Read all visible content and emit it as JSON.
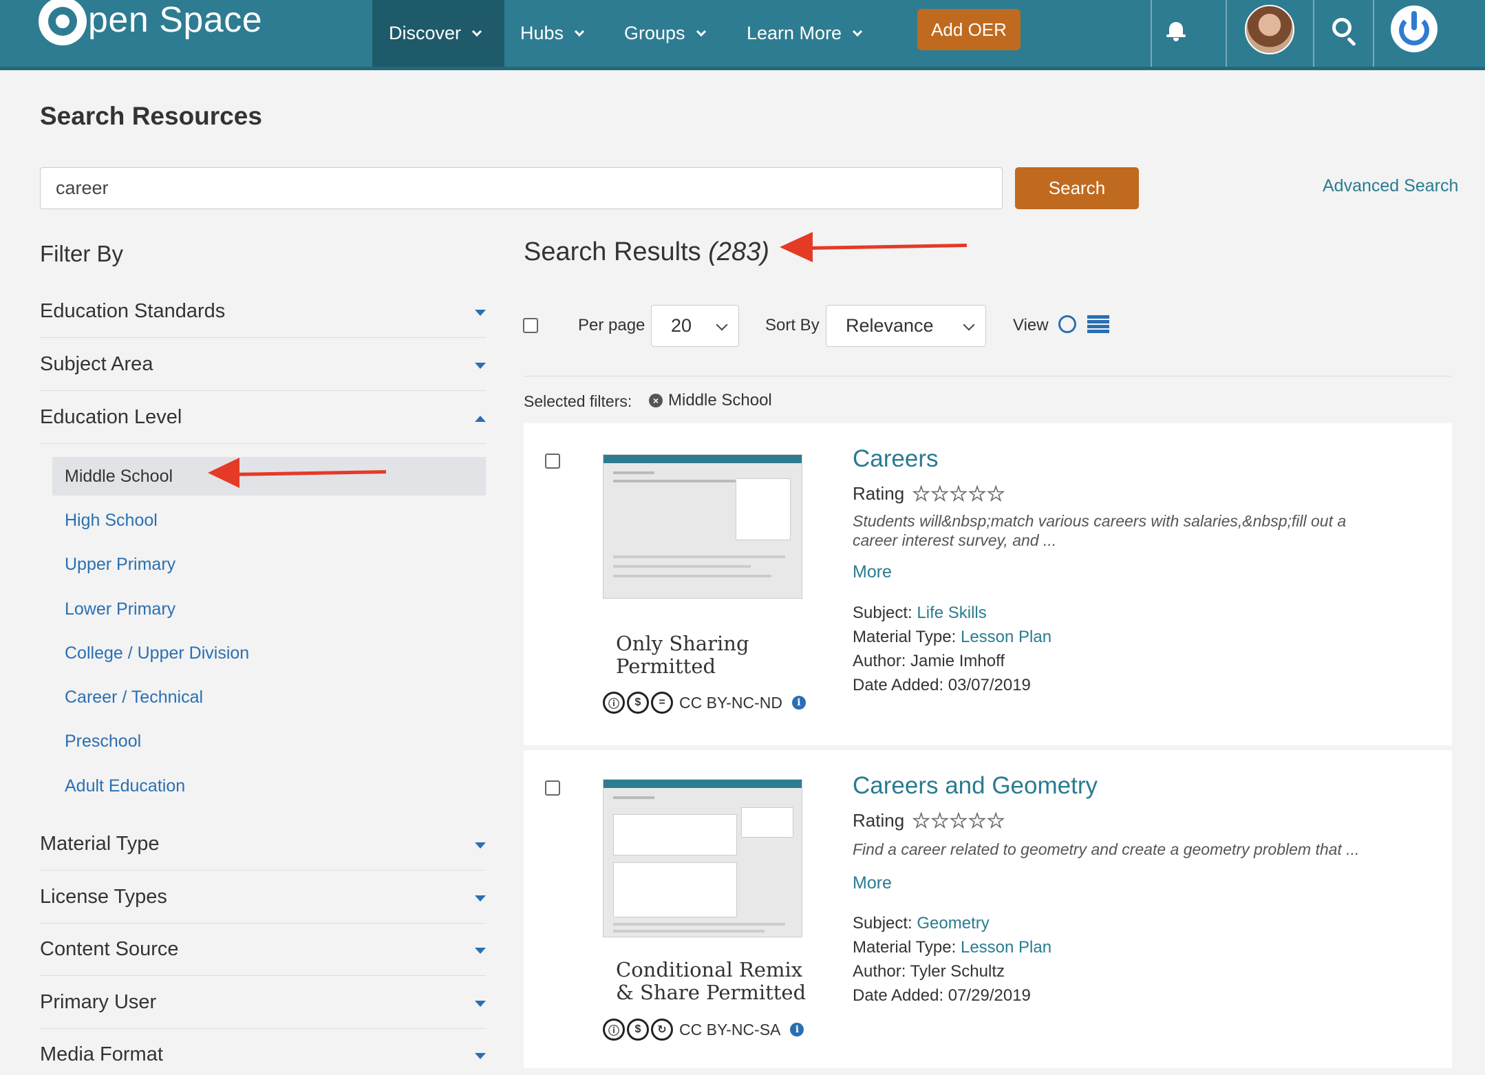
{
  "brand": {
    "logo_text": "pen Space"
  },
  "nav": {
    "discover": "Discover",
    "hubs": "Hubs",
    "groups": "Groups",
    "learn_more": "Learn More",
    "add_oer": "Add OER"
  },
  "page": {
    "title": "Search Resources",
    "search_value": "career",
    "search_button": "Search",
    "advanced_search": "Advanced Search"
  },
  "filters": {
    "title": "Filter By",
    "facets_top": [
      "Education Standards",
      "Subject Area",
      "Education Level"
    ],
    "education_levels": [
      "Middle School",
      "High School",
      "Upper Primary",
      "Lower Primary",
      "College / Upper Division",
      "Career / Technical",
      "Preschool",
      "Adult Education"
    ],
    "selected_level": "Middle School",
    "facets_bottom": [
      "Material Type",
      "License Types",
      "Content Source",
      "Primary User",
      "Media Format"
    ]
  },
  "results": {
    "title": "Search Results",
    "count": "(283)",
    "per_page_label": "Per page",
    "per_page_value": "20",
    "sort_label": "Sort By",
    "sort_value": "Relevance",
    "view_label": "View",
    "selected_filters_label": "Selected filters:",
    "selected_filter_chip": "Middle School",
    "items": [
      {
        "title": "Careers",
        "rating_label": "Rating",
        "stars": "★★★★★",
        "description": "Students will&nbsp;match various careers with salaries,&nbsp;fill out a career interest survey, and ...",
        "more": "More",
        "subject_label": "Subject:",
        "subject": "Life Skills",
        "material_label": "Material Type:",
        "material": "Lesson Plan",
        "author": "Author: Jamie Imhoff",
        "date": "Date Added: 03/07/2019",
        "license_title": "Only Sharing Permitted",
        "license_code": "CC BY-NC-ND"
      },
      {
        "title": "Careers and Geometry",
        "rating_label": "Rating",
        "stars": "★★★★★",
        "description": "Find a career related to geometry and create a geometry problem that ...",
        "more": "More",
        "subject_label": "Subject:",
        "subject": "Geometry",
        "material_label": "Material Type:",
        "material": "Lesson Plan",
        "author": "Author: Tyler Schultz",
        "date": "Date Added: 07/29/2019",
        "license_title": "Conditional Remix & Share Permitted",
        "license_code": "CC BY-NC-SA"
      }
    ]
  },
  "colors": {
    "nav_bg": "#2e7c91",
    "accent_orange": "#c06a1f",
    "link": "#2a7b90",
    "annotation_arrow": "#e43a26"
  }
}
